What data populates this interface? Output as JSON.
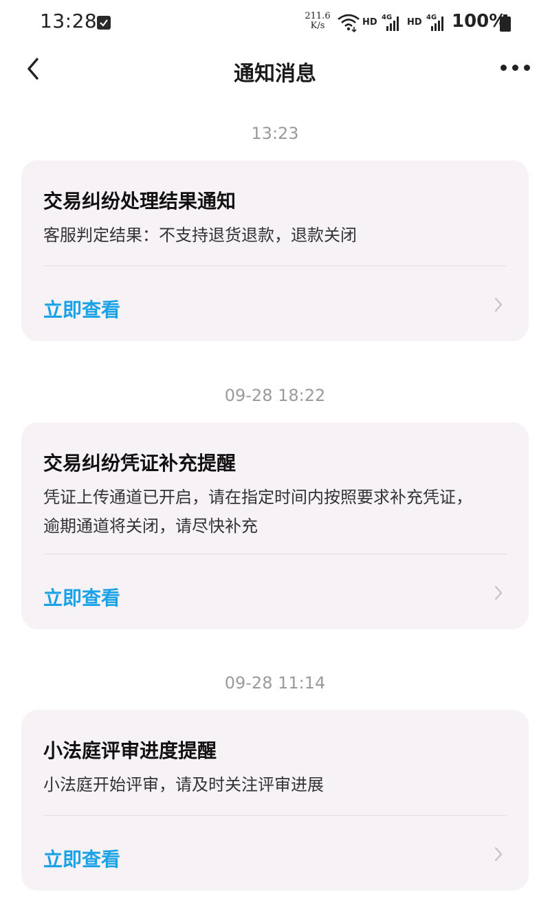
{
  "status_bar": {
    "time": "13:28",
    "network_speed_value": "211.6",
    "network_speed_unit": "K/s",
    "hd1": "HD",
    "hd2": "HD",
    "network1": "4G",
    "network2": "4G",
    "battery": "100%",
    "icons": [
      "check-notification-icon",
      "wifi-icon",
      "signal-icon",
      "battery-icon"
    ]
  },
  "header": {
    "title": "通知消息",
    "back_icon": "chevron-left-icon",
    "more_icon": "more-dots-icon"
  },
  "messages": [
    {
      "time": "13:23",
      "title": "交易纠纷处理结果通知",
      "body_lines": [
        "客服判定结果：不支持退货退款，退款关闭"
      ],
      "action": "立即查看"
    },
    {
      "time": "09-28 18:22",
      "title": "交易纠纷凭证补充提醒",
      "body_lines": [
        "凭证上传通道已开启，请在指定时间内按照要求补充凭证，",
        "逾期通道将关闭，请尽快补充"
      ],
      "action": "立即查看"
    },
    {
      "time": "09-28 11:14",
      "title": "小法庭评审进度提醒",
      "body_lines": [
        "小法庭开始评审，请及时关注评审进展"
      ],
      "action": "立即查看"
    }
  ],
  "colors": {
    "card_background": "#f7f2f5",
    "action_link": "#1aa2e6",
    "time_label": "#9a9a9a"
  }
}
